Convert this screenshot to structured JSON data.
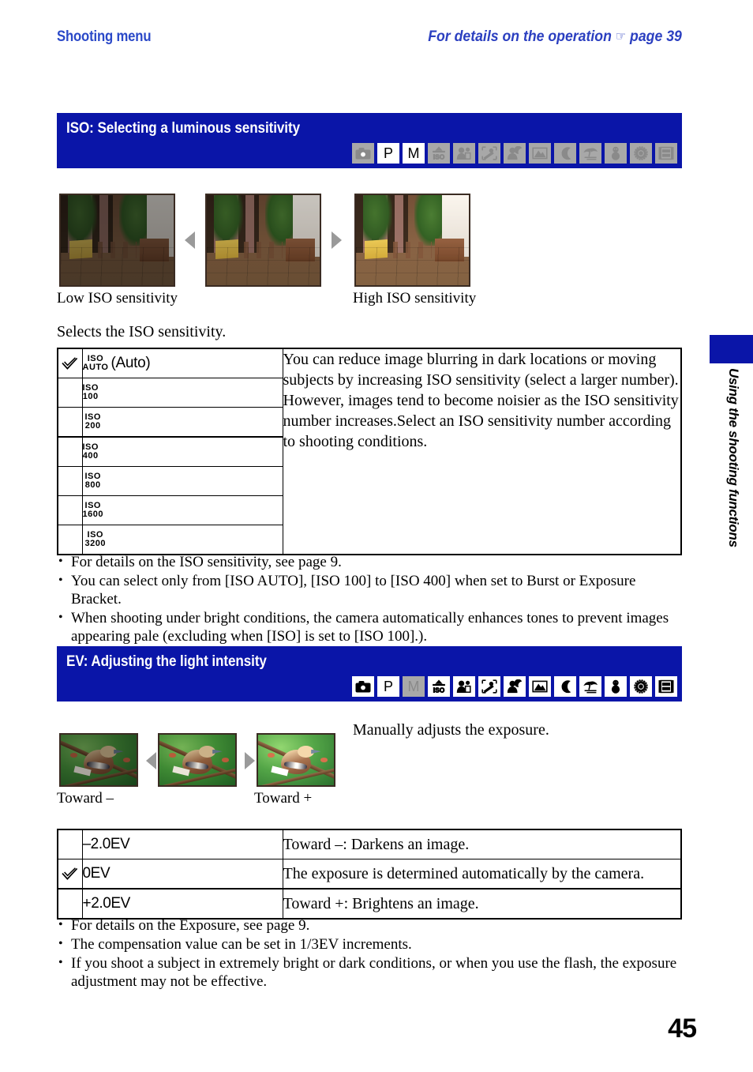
{
  "running_head": {
    "left": "Shooting menu",
    "right_prefix": "For details on the operation",
    "hand_icon": "pointing-hand-icon",
    "right_suffix": "page 39"
  },
  "side_tab": {
    "label": "Using the shooting functions",
    "color": "#0a15a8"
  },
  "page_number": "45",
  "colors": {
    "brand_blue": "#0a15a8",
    "heading_blue": "#2b3fc0",
    "icon_off_bg": "#a8a8a8",
    "icon_on_bg": "#ffffff"
  },
  "sections": [
    {
      "id": "iso",
      "title": "ISO: Selecting a luminous sensitivity",
      "mode_icons": [
        {
          "name": "auto-camera-mode-icon",
          "glyph": "camera",
          "active": false
        },
        {
          "name": "program-mode-icon",
          "glyph": "P",
          "active": true
        },
        {
          "name": "manual-mode-icon",
          "glyph": "M",
          "active": true
        },
        {
          "name": "high-sensitivity-mode-icon",
          "glyph": "iso",
          "active": false
        },
        {
          "name": "soft-snap-mode-icon",
          "glyph": "softsnap",
          "active": false
        },
        {
          "name": "advanced-sports-mode-icon",
          "glyph": "sports",
          "active": false
        },
        {
          "name": "twilight-portrait-mode-icon",
          "glyph": "twilightportrait",
          "active": false
        },
        {
          "name": "landscape-mode-icon",
          "glyph": "landscape",
          "active": false
        },
        {
          "name": "twilight-mode-icon",
          "glyph": "moon",
          "active": false
        },
        {
          "name": "beach-mode-icon",
          "glyph": "beach",
          "active": false
        },
        {
          "name": "snow-mode-icon",
          "glyph": "snow",
          "active": false
        },
        {
          "name": "fireworks-mode-icon",
          "glyph": "fireworks",
          "active": false
        },
        {
          "name": "movie-mode-icon",
          "glyph": "movie",
          "active": false
        }
      ],
      "samples": {
        "left_caption": "Low ISO sensitivity",
        "right_caption": "High ISO sensitivity"
      },
      "intro": "Selects the ISO sensitivity.",
      "table": {
        "rows": [
          {
            "checked": true,
            "tag_top": "ISO",
            "tag_bottom": "AUTO",
            "suffix": "(Auto)"
          },
          {
            "checked": false,
            "tag_top": "ISO",
            "tag_bottom": "100",
            "suffix": ""
          },
          {
            "checked": false,
            "tag_top": "ISO",
            "tag_bottom": "200",
            "suffix": ""
          },
          {
            "checked": false,
            "tag_top": "ISO",
            "tag_bottom": "400",
            "suffix": ""
          },
          {
            "checked": false,
            "tag_top": "ISO",
            "tag_bottom": "800",
            "suffix": ""
          },
          {
            "checked": false,
            "tag_top": "ISO",
            "tag_bottom": "1600",
            "suffix": ""
          },
          {
            "checked": false,
            "tag_top": "ISO",
            "tag_bottom": "3200",
            "suffix": ""
          }
        ],
        "description": "You can reduce image blurring in dark locations or moving subjects by increasing ISO sensitivity (select a larger number). However, images tend to become noisier as the ISO sensitivity number increases.Select an ISO sensitivity number according to shooting conditions."
      },
      "notes": [
        "For details on the ISO sensitivity, see page 9.",
        "You can select only from [ISO AUTO], [ISO 100] to [ISO 400] when set to Burst or Exposure Bracket.",
        "When shooting under bright conditions, the camera automatically enhances tones to prevent images appearing pale (excluding when [ISO] is set to [ISO 100].)."
      ]
    },
    {
      "id": "ev",
      "title": "EV: Adjusting the light intensity",
      "mode_icons": [
        {
          "name": "auto-camera-mode-icon",
          "glyph": "camera",
          "active": true
        },
        {
          "name": "program-mode-icon",
          "glyph": "P",
          "active": true
        },
        {
          "name": "manual-mode-icon",
          "glyph": "M",
          "active": false
        },
        {
          "name": "high-sensitivity-mode-icon",
          "glyph": "iso",
          "active": true
        },
        {
          "name": "soft-snap-mode-icon",
          "glyph": "softsnap",
          "active": true
        },
        {
          "name": "advanced-sports-mode-icon",
          "glyph": "sports",
          "active": true
        },
        {
          "name": "twilight-portrait-mode-icon",
          "glyph": "twilightportrait",
          "active": true
        },
        {
          "name": "landscape-mode-icon",
          "glyph": "landscape",
          "active": true
        },
        {
          "name": "twilight-mode-icon",
          "glyph": "moon",
          "active": true
        },
        {
          "name": "beach-mode-icon",
          "glyph": "beach",
          "active": true
        },
        {
          "name": "snow-mode-icon",
          "glyph": "snow",
          "active": true
        },
        {
          "name": "fireworks-mode-icon",
          "glyph": "fireworks",
          "active": true
        },
        {
          "name": "movie-mode-icon",
          "glyph": "movie",
          "active": true
        }
      ],
      "samples": {
        "left_caption": "Toward –",
        "right_caption": "Toward +"
      },
      "intro": "Manually adjusts the exposure.",
      "table": {
        "rows": [
          {
            "checked": false,
            "value": "–2.0EV",
            "desc": "Toward –: Darkens an image."
          },
          {
            "checked": true,
            "value": "0EV",
            "desc": "The exposure is determined automatically by the camera."
          },
          {
            "checked": false,
            "value": "+2.0EV",
            "desc": "Toward +: Brightens an image."
          }
        ]
      },
      "notes": [
        "For details on the Exposure, see page 9.",
        "The compensation value can be set in 1/3EV increments.",
        "If you shoot a subject in extremely bright or dark conditions, or when you use the flash, the exposure adjustment may not be effective."
      ]
    }
  ]
}
